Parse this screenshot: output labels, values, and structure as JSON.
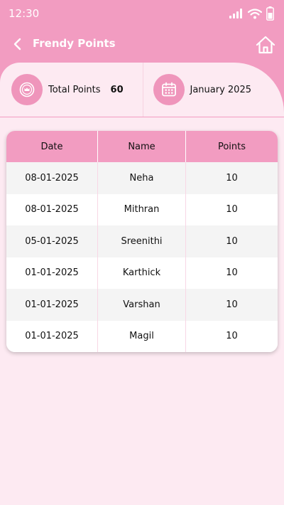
{
  "status_bar": {
    "time": "12:30"
  },
  "nav": {
    "title": "Frendy Points"
  },
  "summary": {
    "total_points_label": "Total Points",
    "total_points_value": "60",
    "month_label": "January 2025"
  },
  "table": {
    "headers": [
      "Date",
      "Name",
      "Points"
    ],
    "rows": [
      {
        "date": "08-01-2025",
        "name": "Neha",
        "points": "10"
      },
      {
        "date": "08-01-2025",
        "name": "Mithran",
        "points": "10"
      },
      {
        "date": "05-01-2025",
        "name": "Sreenithi",
        "points": "10"
      },
      {
        "date": "01-01-2025",
        "name": "Karthick",
        "points": "10"
      },
      {
        "date": "01-01-2025",
        "name": "Varshan",
        "points": "10"
      },
      {
        "date": "01-01-2025",
        "name": "Magil",
        "points": "10"
      }
    ]
  },
  "colors": {
    "accent": "#f29cc1",
    "background": "#fdeaf2",
    "row_alt": "#f4f4f4"
  },
  "icons": {
    "back": "chevron-left-icon",
    "home": "home-icon",
    "points": "crown-badge-icon",
    "calendar": "calendar-icon",
    "signal": "signal-icon",
    "wifi": "wifi-icon",
    "battery": "battery-icon"
  }
}
